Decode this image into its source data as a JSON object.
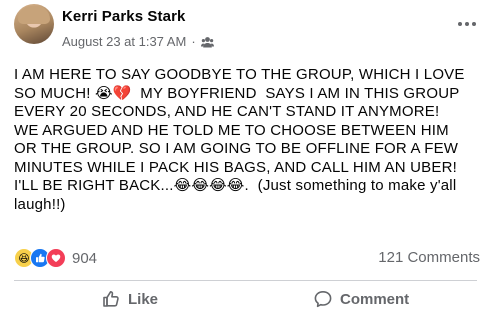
{
  "post": {
    "author": "Kerri Parks Stark",
    "timestamp": "August 23 at 1:37 AM",
    "separator": "·",
    "text": "I AM HERE TO SAY GOODBYE TO THE GROUP, WHICH I LOVE\nSO MUCH! 😭💔  MY BOYFRIEND  SAYS I AM IN THIS GROUP\nEVERY 20 SECONDS, AND HE CAN'T STAND IT ANYMORE!\nWE ARGUED AND HE TOLD ME TO CHOOSE BETWEEN HIM\nOR THE GROUP. SO I AM GOING TO BE OFFLINE FOR A FEW\nMINUTES WHILE I PACK HIS BAGS, AND CALL HIM AN UBER!\nI'LL BE RIGHT BACK...😂😂😂😂.  (Just something to make y'all\nlaugh!!)"
  },
  "stats": {
    "reaction_count": "904",
    "comments": "121 Comments",
    "reaction_types": [
      "haha",
      "like",
      "love"
    ]
  },
  "actions": {
    "like": "Like",
    "comment": "Comment"
  },
  "icons": {
    "privacy": "group-icon",
    "menu": "more-dots-icon"
  }
}
